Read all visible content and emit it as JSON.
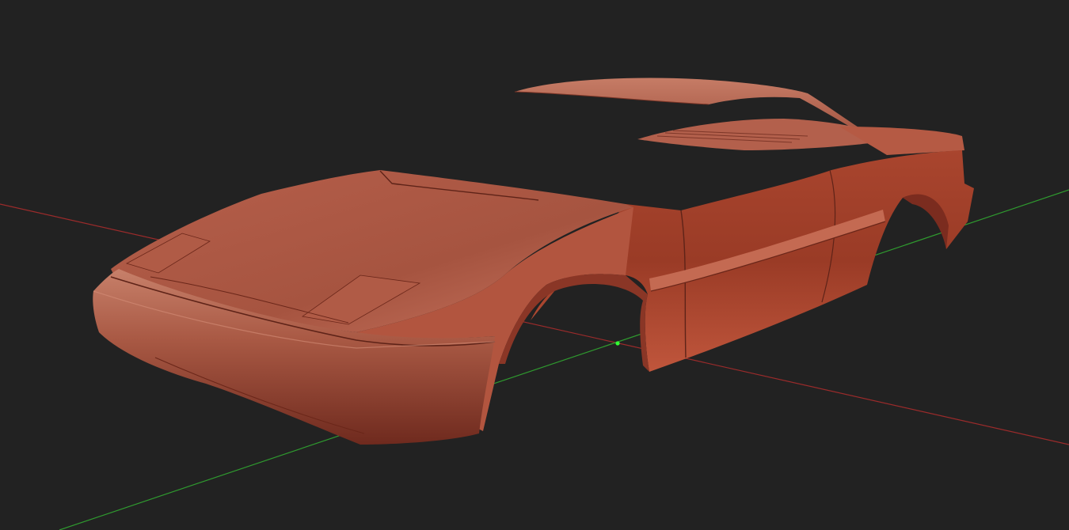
{
  "viewport": {
    "background": "#222222",
    "view": "3d-perspective",
    "object": "car-body-mesh",
    "shading": "matcap-red-clay"
  },
  "axes": {
    "x_axis_color": "#9b2b2b",
    "y_axis_color": "#2f9a2f",
    "grid_visible": false
  },
  "model": {
    "body_color": "#b24f3c",
    "highlight_color": "#d47a62",
    "shadow_color": "#6e2a1f",
    "parts": [
      "hood",
      "front-bumper",
      "front-wheel-arch",
      "door",
      "rear-quarter",
      "rear-wheel-arch",
      "roof-panel",
      "rear-deck"
    ]
  },
  "origin": {
    "color": "#33ff33"
  }
}
